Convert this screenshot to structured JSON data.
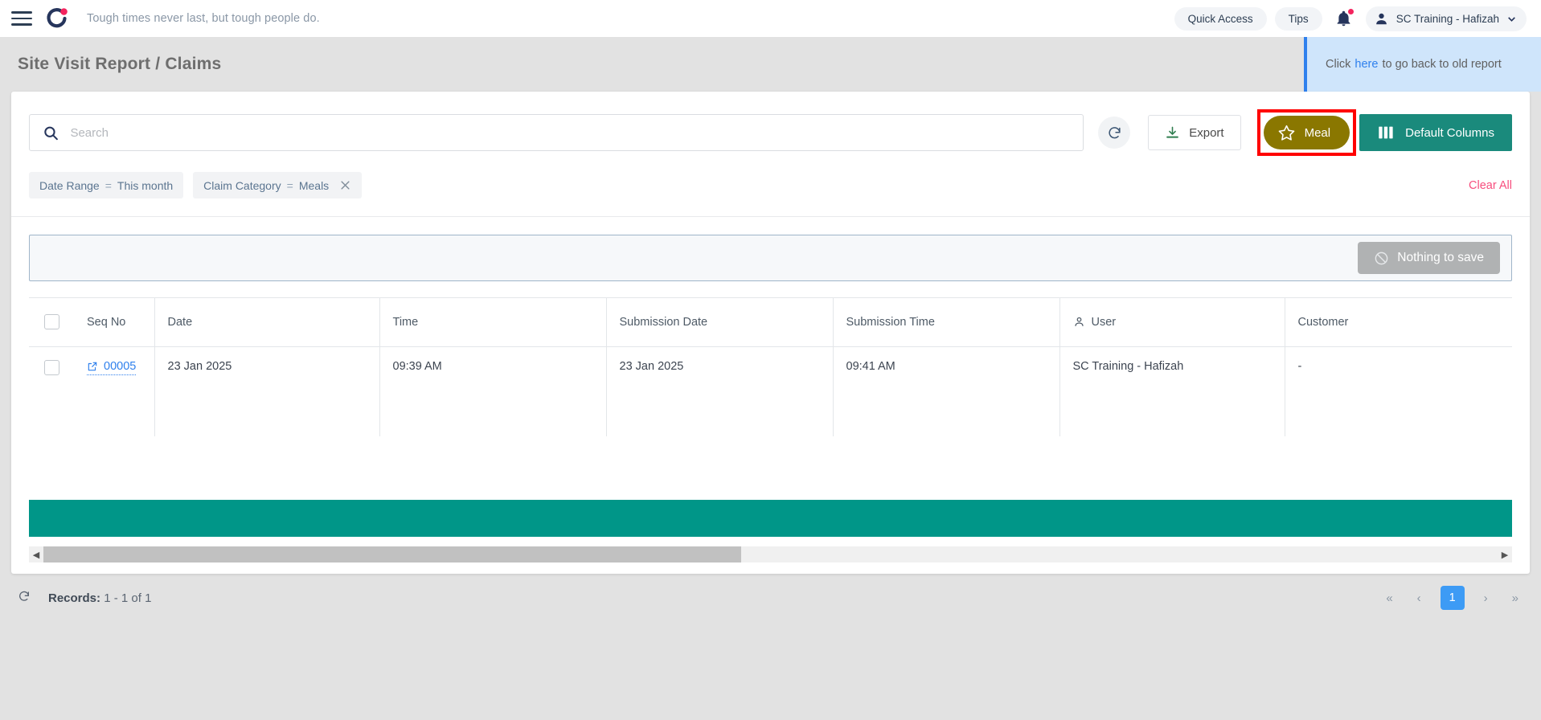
{
  "topbar": {
    "menu_icon": "hamburger-icon",
    "logo_icon": "brand-logo-icon",
    "quote": "Tough times never last, but tough people do.",
    "quick_access": "Quick Access",
    "tips": "Tips",
    "notification_icon": "bell-icon",
    "user_name": "SC Training - Hafizah"
  },
  "page": {
    "title": "Site Visit Report / Claims",
    "banner_prefix": "Click",
    "banner_link": "here",
    "banner_suffix": "to go back to old report"
  },
  "toolbar": {
    "search_placeholder": "Search",
    "search_value": "",
    "refresh_icon": "refresh-icon",
    "export_label": "Export",
    "meal_label": "Meal",
    "columns_label": "Default Columns"
  },
  "filters": {
    "chips": [
      {
        "field": "Date Range",
        "op": "=",
        "value": "This month",
        "removable": false
      },
      {
        "field": "Claim Category",
        "op": "=",
        "value": "Meals",
        "removable": true
      }
    ],
    "clear_all": "Clear All"
  },
  "savebar": {
    "button_label": "Nothing to save",
    "button_icon": "no-entry-icon"
  },
  "table": {
    "columns": [
      {
        "label": "Seq No",
        "icon": ""
      },
      {
        "label": "Date",
        "icon": ""
      },
      {
        "label": "Time",
        "icon": ""
      },
      {
        "label": "Submission Date",
        "icon": ""
      },
      {
        "label": "Submission Time",
        "icon": ""
      },
      {
        "label": "User",
        "icon": "user-icon"
      },
      {
        "label": "Customer",
        "icon": ""
      }
    ],
    "rows": [
      {
        "seq_no": "00005",
        "date": "23 Jan 2025",
        "time": "09:39 AM",
        "submission_date": "23 Jan 2025",
        "submission_time": "09:41 AM",
        "user": "SC Training - Hafizah",
        "customer": "-"
      }
    ]
  },
  "footer": {
    "refresh_icon": "refresh-icon",
    "records_label": "Records:",
    "records_range": "1 - 1",
    "records_of": "of",
    "records_total": "1",
    "pager": {
      "first": "«",
      "prev": "‹",
      "current": "1",
      "next": "›",
      "last": "»"
    }
  },
  "colors": {
    "accent_teal": "#009688",
    "columns_teal": "#1a8a7c",
    "meal_olive": "#8a7700",
    "highlight_red": "#ff0000",
    "link_blue": "#2f80ed",
    "clear_pink": "#f74e7e",
    "page_active_blue": "#3d9bf5"
  }
}
